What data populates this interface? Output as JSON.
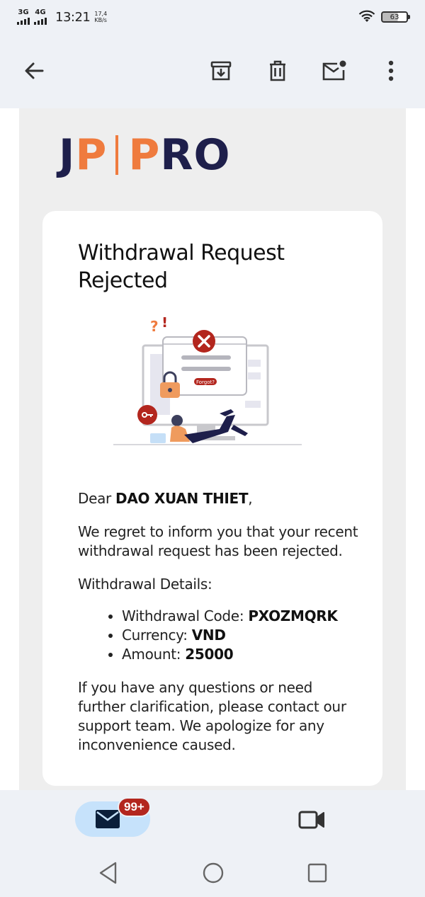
{
  "status_bar": {
    "net1": "3G",
    "net2": "4G",
    "time": "13:21",
    "speed_value": "17,4",
    "speed_unit": "KB/s",
    "battery": "63"
  },
  "app_bar": {
    "icons": [
      "back-arrow-icon",
      "archive-icon",
      "delete-icon",
      "mark-unread-icon",
      "more-vert-icon"
    ]
  },
  "email": {
    "logo_left": "JP",
    "logo_right": "PRO",
    "title_line1": "Withdrawal Request",
    "title_line2": "Rejected",
    "illustration_label": "Forgot?",
    "greeting_prefix": "Dear ",
    "recipient": "DAO XUAN THIET",
    "greeting_suffix": ",",
    "message": "We regret to inform you that your recent withdrawal request has been rejected.",
    "details_heading": "Withdrawal Details:",
    "details": [
      {
        "label": "Withdrawal Code: ",
        "value": "PXOZMQRK"
      },
      {
        "label": "Currency: ",
        "value": "VND"
      },
      {
        "label": "Amount: ",
        "value": "25000"
      }
    ],
    "closing": "If you have any questions or need further clarification, please contact our support team. We apologize for any inconvenience caused."
  },
  "bottom_nav": {
    "mail_badge": "99+"
  },
  "colors": {
    "brand_navy": "#1e1f4b",
    "brand_orange": "#ef7b3e",
    "badge_red": "#b3261e",
    "pill_blue": "#c6e2fb"
  }
}
